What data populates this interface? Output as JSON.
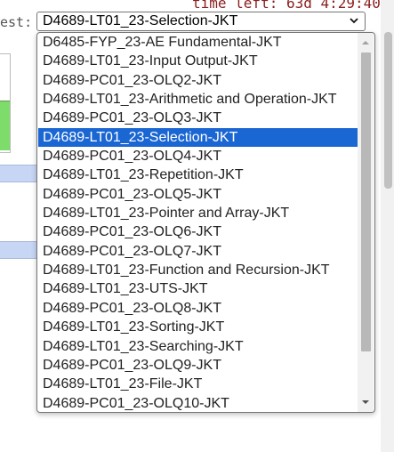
{
  "header": {
    "time_left": "time left: 63d 4:29:40",
    "contest_label_fragment": "est:"
  },
  "contest_select": {
    "selected_value": "D4689-LT01_23-Selection-JKT"
  },
  "dropdown": {
    "options": [
      "D6485-FYP_23-AE Fundamental-JKT",
      "D4689-LT01_23-Input Output-JKT",
      "D4689-PC01_23-OLQ2-JKT",
      "D4689-LT01_23-Arithmetic and Operation-JKT",
      "D4689-PC01_23-OLQ3-JKT",
      "D4689-LT01_23-Selection-JKT",
      "D4689-PC01_23-OLQ4-JKT",
      "D4689-LT01_23-Repetition-JKT",
      "D4689-PC01_23-OLQ5-JKT",
      "D4689-LT01_23-Pointer and Array-JKT",
      "D4689-PC01_23-OLQ6-JKT",
      "D4689-PC01_23-OLQ7-JKT",
      "D4689-LT01_23-Function and Recursion-JKT",
      "D4689-LT01_23-UTS-JKT",
      "D4689-PC01_23-OLQ8-JKT",
      "D4689-LT01_23-Sorting-JKT",
      "D4689-LT01_23-Searching-JKT",
      "D4689-PC01_23-OLQ9-JKT",
      "D4689-LT01_23-File-JKT",
      "D4689-PC01_23-OLQ10-JKT"
    ],
    "selected_index": 5
  },
  "colors": {
    "selection_highlight": "#1a66d2",
    "time_left_text": "#8a1f1f",
    "left_green_bar": "#7ddc6a",
    "band_blue": "#c7d6f5"
  },
  "icons": {
    "select_chevron": "chevron-down-icon",
    "scroll_up": "scroll-up-arrow-icon",
    "scroll_down": "scroll-down-arrow-icon"
  }
}
